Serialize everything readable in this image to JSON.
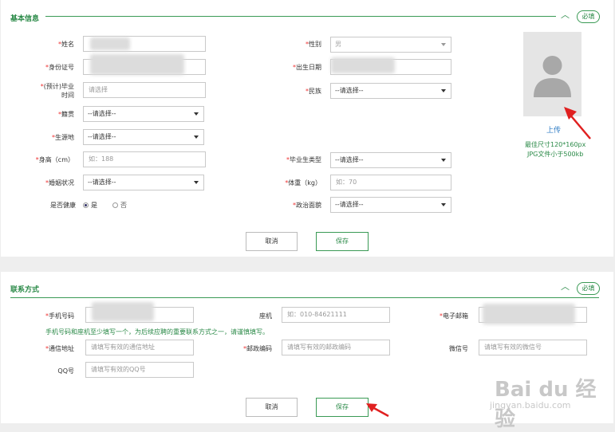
{
  "basic": {
    "title": "基本信息",
    "required_badge": "必填",
    "name_label": "姓名",
    "gender_label": "性别",
    "gender_value": "男",
    "id_label": "身份证号",
    "birth_label": "出生日期",
    "grad_label_1": "(预计)毕业",
    "grad_label_2": "时间",
    "grad_placeholder": "请选择",
    "ethnic_label": "民族",
    "ethnic_value": "--请选择--",
    "native_label": "籍贯",
    "native_value": "--请选择--",
    "birthplace_label": "生源地",
    "birthplace_value": "--请选择--",
    "height_label": "身高（cm）",
    "height_placeholder": "如：188",
    "gradtype_label": "毕业生类型",
    "gradtype_value": "--请选择--",
    "marital_label": "婚姻状况",
    "marital_value": "--请选择--",
    "weight_label": "体重（kg）",
    "weight_placeholder": "如：70",
    "health_label": "是否健康",
    "health_yes": "是",
    "health_no": "否",
    "political_label": "政治面貌",
    "political_value": "--请选择--",
    "upload_label": "上传",
    "photo_hint_1": "最佳尺寸120*160px",
    "photo_hint_2": "JPG文件小于500kb",
    "cancel_label": "取消",
    "save_label": "保存"
  },
  "contact": {
    "title": "联系方式",
    "required_badge": "必填",
    "phone_label": "手机号码",
    "landline_label": "座机",
    "landline_placeholder": "如：010-84621111",
    "email_label": "电子邮箱",
    "phone_hint": "手机号码和座机至少填写一个，为后续应聘的重要联系方式之一，请谨慎填写。",
    "address_label": "通信地址",
    "address_placeholder": "请填写有效的通信地址",
    "postcode_label": "邮政编码",
    "postcode_placeholder": "请填写有效的邮政编码",
    "wechat_label": "微信号",
    "wechat_placeholder": "请填写有效的微信号",
    "qq_label": "QQ号",
    "qq_placeholder": "请填写有效的QQ号",
    "cancel_label": "取消",
    "save_label": "保存"
  },
  "watermark": {
    "brand": "Bai du 经验",
    "url": "jingyan.baidu.com"
  },
  "colors": {
    "accent": "#2b8a48",
    "required": "#e33333",
    "annotation_arrow": "#e02020"
  }
}
